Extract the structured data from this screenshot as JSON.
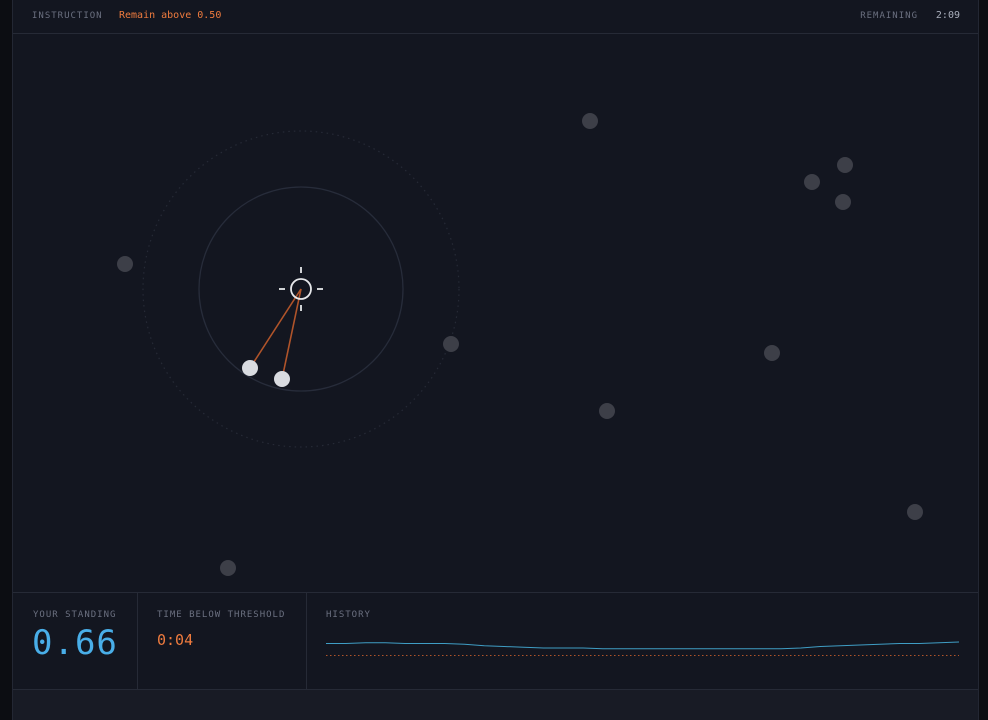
{
  "header": {
    "instruction_label": "INSTRUCTION",
    "instruction_text": "Remain above 0.50",
    "remaining_label": "REMAINING",
    "remaining_value": "2:09"
  },
  "stats": {
    "standing_label": "YOUR STANDING",
    "standing_value": "0.66",
    "below_label": "TIME BELOW THRESHOLD",
    "below_value": "0:04",
    "history_label": "HISTORY"
  },
  "colors": {
    "accent_orange": "#ef7b3e",
    "accent_blue": "#49aee8",
    "node_idle": "#3d3f48",
    "node_linked": "#d9dbe0"
  },
  "icons": {
    "player": "crosshair-icon"
  },
  "game": {
    "linked_node_count": 2,
    "idle_node_count": 12
  },
  "history": {
    "threshold": 0.5,
    "values": [
      0.66,
      0.66,
      0.67,
      0.67,
      0.66,
      0.66,
      0.66,
      0.65,
      0.63,
      0.62,
      0.61,
      0.6,
      0.6,
      0.6,
      0.59,
      0.59,
      0.59,
      0.59,
      0.59,
      0.59,
      0.59,
      0.59,
      0.59,
      0.59,
      0.6,
      0.62,
      0.63,
      0.64,
      0.65,
      0.66,
      0.66,
      0.67,
      0.68
    ]
  }
}
